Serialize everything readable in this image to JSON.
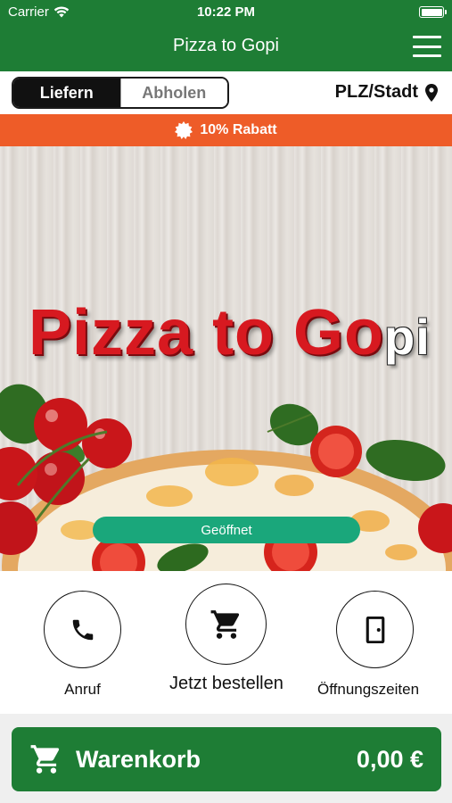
{
  "status_bar": {
    "carrier": "Carrier",
    "time": "10:22 PM"
  },
  "header": {
    "title": "Pizza to Gopi",
    "menu_icon": "hamburger-menu-icon"
  },
  "mode_toggle": {
    "options": [
      "Liefern",
      "Abholen"
    ],
    "selected": "Liefern"
  },
  "location": {
    "label": "PLZ/Stadt",
    "icon": "location-pin-icon"
  },
  "promo": {
    "text": "10% Rabatt",
    "icon": "badge-icon"
  },
  "hero": {
    "logo_main": "Pizza to Go",
    "logo_suffix": "pi",
    "status_badge": "Geöffnet"
  },
  "actions": [
    {
      "label": "Anruf",
      "icon": "phone-icon"
    },
    {
      "label": "Jetzt bestellen",
      "icon": "cart-icon"
    },
    {
      "label": "Öffnungszeiten",
      "icon": "door-icon"
    }
  ],
  "cart": {
    "label": "Warenkorb",
    "total": "0,00 €",
    "icon": "cart-icon"
  },
  "colors": {
    "brand_green": "#1e7d35",
    "promo_orange": "#ee5c28",
    "open_badge": "#1aa77b",
    "logo_red": "#d71920"
  }
}
